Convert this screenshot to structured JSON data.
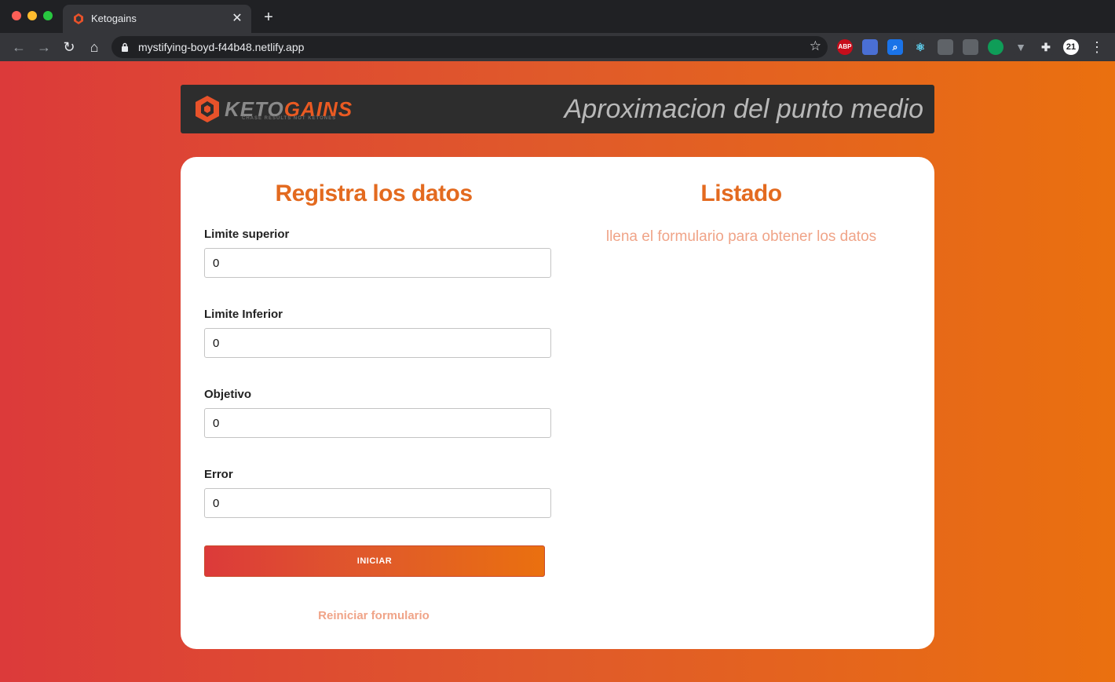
{
  "browser": {
    "tab_title": "Ketogains",
    "tab_close": "✕",
    "new_tab": "+",
    "url": "mystifying-boyd-f44b48.netlify.app",
    "extensions": [
      {
        "name": "adblock-plus",
        "label": "ABP",
        "color": "#c70d1b"
      },
      {
        "name": "extension-2",
        "label": "",
        "color": "#4a6fd4"
      },
      {
        "name": "extension-search",
        "label": "",
        "color": "#1a73e8"
      },
      {
        "name": "react-devtools",
        "label": "",
        "color": "#35363a"
      },
      {
        "name": "extension-5",
        "label": "",
        "color": "#5f6368"
      },
      {
        "name": "extension-6",
        "label": "",
        "color": "#5f6368"
      },
      {
        "name": "extension-7",
        "label": "",
        "color": "#0f9d58"
      },
      {
        "name": "vue-devtools",
        "label": "",
        "color": "#35363a"
      },
      {
        "name": "extensions-puzzle",
        "label": "",
        "color": "#35363a"
      },
      {
        "name": "extension-21",
        "label": "21",
        "color": "#ffffff"
      }
    ]
  },
  "header": {
    "logo_keto": "KETO",
    "logo_gains": "GAINS",
    "logo_tagline": "CHASE RESULTS NOT KETONES",
    "title": "Aproximacion del punto medio"
  },
  "form": {
    "title": "Registra los datos",
    "fields": [
      {
        "label": "Limite superior",
        "value": "0"
      },
      {
        "label": "Limite Inferior",
        "value": "0"
      },
      {
        "label": "Objetivo",
        "value": "0"
      },
      {
        "label": "Error",
        "value": "0"
      }
    ],
    "submit_label": "INICIAR",
    "reset_label": "Reiniciar formulario"
  },
  "list": {
    "title": "Listado",
    "empty_message": "llena el formulario para obtener los datos"
  },
  "colors": {
    "accent": "#e36a1f",
    "muted_accent": "#f0a488",
    "gradient_start": "#dc3a3a",
    "gradient_end": "#ea700f"
  }
}
